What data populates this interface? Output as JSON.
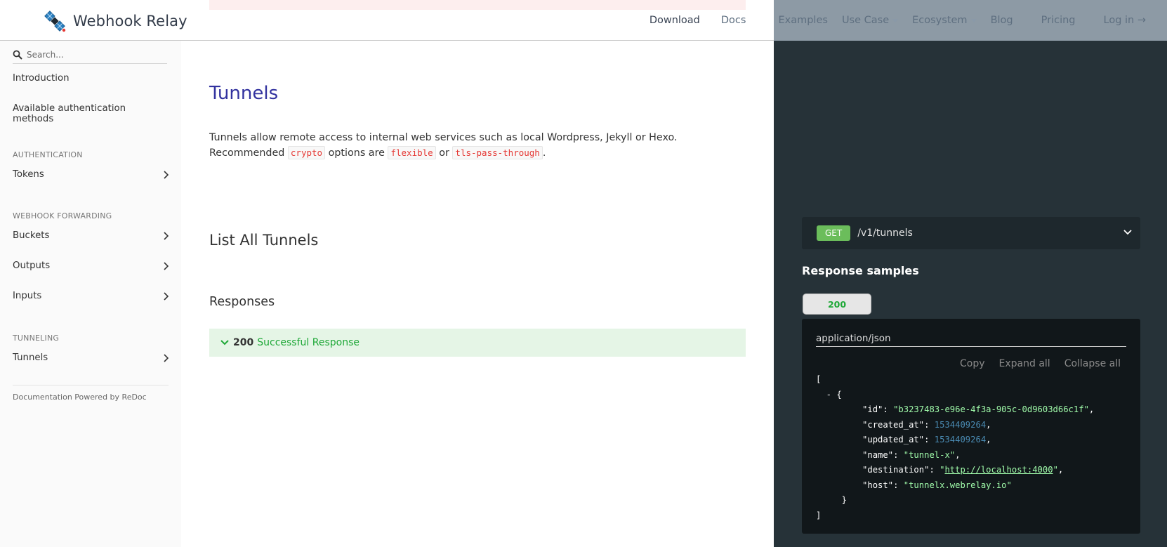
{
  "brand": {
    "name": "Webhook Relay",
    "logo_icon": "satellite-logo-icon"
  },
  "nav": {
    "download": "Download",
    "docs": "Docs",
    "examples": "Examples",
    "use_case": "Use Case",
    "ecosystem": "Ecosystem",
    "blog": "Blog",
    "pricing": "Pricing",
    "login": "Log in →"
  },
  "sidebar": {
    "search_placeholder": "Search...",
    "intro": "Introduction",
    "auth_methods": "Available authentication methods",
    "section_auth": "AUTHENTICATION",
    "tokens": "Tokens",
    "section_forwarding": "WEBHOOK FORWARDING",
    "buckets": "Buckets",
    "outputs": "Outputs",
    "inputs": "Inputs",
    "section_tunneling": "TUNNELING",
    "tunnels": "Tunnels",
    "powered": "Documentation Powered by ReDoc"
  },
  "main": {
    "title": "Tunnels",
    "desc_1": "Tunnels allow remote access to internal web services such as local Wordpress, Jekyll or Hexo.",
    "desc_2a": "Recommended",
    "code_crypto": "crypto",
    "desc_2b": "options are",
    "code_flexible": "flexible",
    "desc_2c": "or",
    "code_tls": "tls-pass-through",
    "desc_2d": ".",
    "operation_title": "List All Tunnels",
    "responses_title": "Responses",
    "response": {
      "code": "200",
      "description": "Successful Response"
    }
  },
  "right": {
    "method": "GET",
    "path": "/v1/tunnels",
    "samples_title": "Response samples",
    "tab": "200",
    "content_type": "application/json",
    "copy": "Copy",
    "expand": "Expand all",
    "collapse": "Collapse all",
    "sample": {
      "id": "b3237483-e96e-4f3a-905c-0d9603d66c1f",
      "created_at": "1534409264",
      "updated_at": "1534409264",
      "name": "tunnel-x",
      "destination": "http://localhost:4000",
      "host": "tunnelx.webrelay.io"
    }
  },
  "colors": {
    "title_blue": "#32329f",
    "success_green": "#1ea837",
    "dark_panel": "#263238",
    "method_green": "#6bbd5b"
  }
}
